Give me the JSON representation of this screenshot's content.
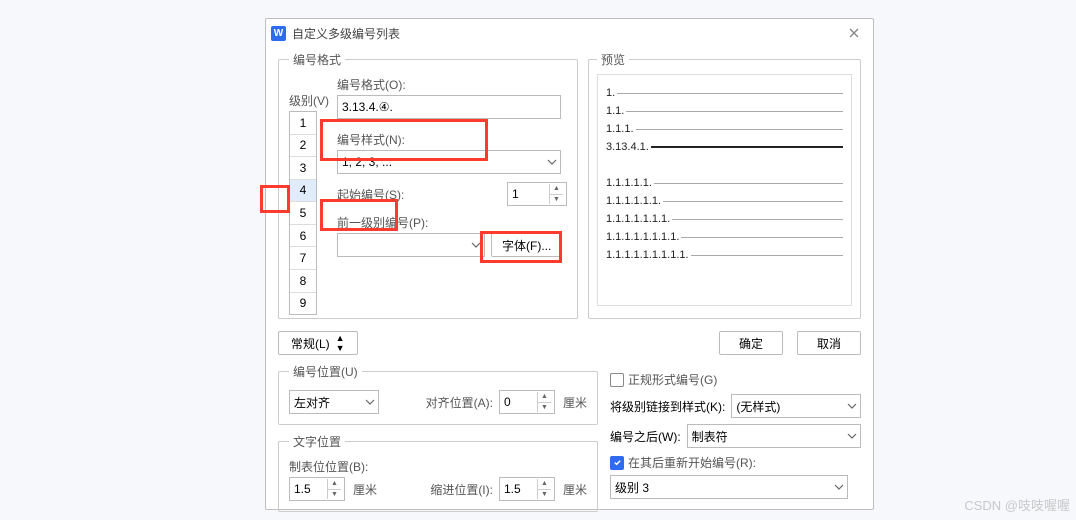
{
  "dialog": {
    "title": "自定义多级编号列表",
    "app_icon_letter": "W"
  },
  "format_fs": {
    "legend": "编号格式",
    "level_label": "级别(V)",
    "levels": [
      "1",
      "2",
      "3",
      "4",
      "5",
      "6",
      "7",
      "8",
      "9"
    ],
    "selected_level": "4",
    "number_format_label": "编号格式(O):",
    "number_format_value": "3.13.4.④.",
    "number_style_label": "编号样式(N):",
    "number_style_value": "1, 2, 3, ...",
    "start_at_label": "起始编号(S):",
    "start_at_value": "1",
    "prev_level_label": "前一级别编号(P):",
    "font_btn": "字体(F)..."
  },
  "preview_fs": {
    "legend": "预览",
    "lines": [
      {
        "num": "1.",
        "bold": false
      },
      {
        "num": "1.1.",
        "bold": false
      },
      {
        "num": "1.1.1.",
        "bold": false
      },
      {
        "num": "3.13.4.1.",
        "bold": true
      },
      {
        "num": "1.1.1.1.1.",
        "bold": false
      },
      {
        "num": "1.1.1.1.1.1.",
        "bold": false
      },
      {
        "num": "1.1.1.1.1.1.1.",
        "bold": false
      },
      {
        "num": "1.1.1.1.1.1.1.1.",
        "bold": false
      },
      {
        "num": "1.1.1.1.1.1.1.1.1.",
        "bold": false
      }
    ]
  },
  "mid": {
    "normal_btn": "常规(L)",
    "ok_btn": "确定",
    "cancel_btn": "取消"
  },
  "numpos_fs": {
    "legend": "编号位置(U)",
    "align_value": "左对齐",
    "align_label": "对齐位置(A):",
    "align_num": "0",
    "cm": "厘米"
  },
  "txtpos_fs": {
    "legend": "文字位置",
    "tab_label": "制表位位置(B):",
    "tab_value": "1.5",
    "indent_label": "缩进位置(I):",
    "indent_value": "1.5",
    "cm": "厘米"
  },
  "rightcol": {
    "regular_label": "正规形式编号(G)",
    "link_label": "将级别链接到样式(K):",
    "link_value": "(无样式)",
    "after_label": "编号之后(W):",
    "after_value": "制表符",
    "restart_label": "在其后重新开始编号(R):",
    "restart_value": "级别 3"
  },
  "watermark": "CSDN @吱吱喔喔"
}
